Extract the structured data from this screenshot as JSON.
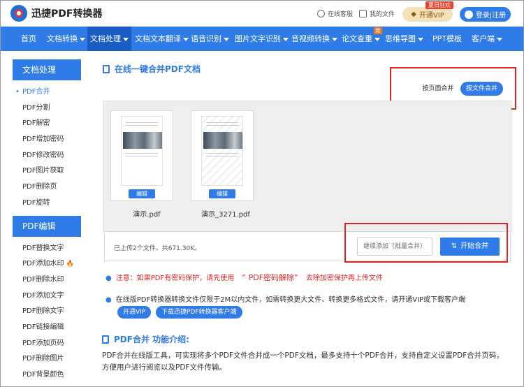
{
  "header": {
    "logo_text": "迅捷PDF转换器",
    "service_label": "在线客服",
    "my_files_label": "我的文件",
    "vip_label": "开通VIP",
    "vip_badge": "夏日狂欢",
    "login_label": "登录|注册"
  },
  "nav": {
    "items": [
      "首页",
      "文档转换",
      "文档处理",
      "文档文本翻译",
      "语音识别",
      "图片文字识别",
      "音视频转换",
      "论文查重",
      "思维导图",
      "PPT模板",
      "客户端"
    ],
    "new_badge": "新"
  },
  "sidebar": {
    "group1_title": "文档处理",
    "group1_items": [
      "PDF合并",
      "PDF分割",
      "PDF解密",
      "PDF增加密码",
      "PDF修改密码",
      "PDF图片获取",
      "PDF删除页",
      "PDF旋转"
    ],
    "group2_title": "PDF编辑",
    "group2_items": [
      "PDF替换文字",
      "PDF添加水印",
      "PDF删除水印",
      "PDF添加文字",
      "PDF删除文字",
      "PDF链接编辑",
      "PDF添加页码",
      "PDF删除图片",
      "PDF背景颜色"
    ]
  },
  "main": {
    "title": "在线一键合并PDF文档",
    "mode_page": "按页面合并",
    "mode_file": "按文件合并",
    "files": [
      {
        "name": "演示.pdf",
        "edit": "编辑"
      },
      {
        "name": "演示_3271.pdf",
        "edit": "编辑"
      }
    ],
    "status": "已上传2个文件，共671.30K。",
    "add_more": "继续添加（批量合并）",
    "start": "开始合并",
    "note1_a": "注意：如果PDF有密码保护，请先使用",
    "note1_link": "“ PDF密码解除”",
    "note1_b": "去除加密保护再上传文件",
    "note2": "在线版PDF转换器转换文件仅限于2M以内文件，如需转换更大文件、转换更多格式文件，请开通VIP或下载客户端",
    "btn_vip": "开通VIP",
    "btn_download": "下载迅捷PDF转换器客户端",
    "intro_title": "PDF合并 功能介绍:",
    "intro_text": "PDF合并在线版工具，可实现将多个PDF文件合并成一个PDF文档，最多支持十个PDF合并，支持自定义设置PDF合并页码，方便用户进行阅览以及PDF文件传输。"
  }
}
